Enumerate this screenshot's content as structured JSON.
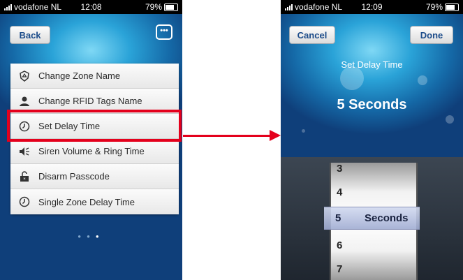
{
  "left_screen": {
    "status": {
      "carrier": "vodafone NL",
      "time": "12:08",
      "battery": "79%"
    },
    "back_label": "Back",
    "chat_icon": "chat-bubble-icon",
    "menu_items": [
      {
        "label": "Change Zone Name",
        "icon": "shield-icon"
      },
      {
        "label": "Change RFID Tags Name",
        "icon": "person-icon"
      },
      {
        "label": "Set Delay Time",
        "icon": "clock-icon"
      },
      {
        "label": "Siren Volume & Ring Time",
        "icon": "speaker-icon"
      },
      {
        "label": "Disarm Passcode",
        "icon": "lock-icon"
      },
      {
        "label": "Single Zone Delay Time",
        "icon": "clock-icon"
      }
    ],
    "highlight_color": "#e4001c",
    "page_dots": {
      "count": 3,
      "active": 3
    }
  },
  "right_screen": {
    "status": {
      "carrier": "vodafone NL",
      "time": "12:09",
      "battery": "79%"
    },
    "cancel_label": "Cancel",
    "done_label": "Done",
    "title": "Set Delay Time",
    "value_display": "5 Seconds",
    "picker": {
      "rows": [
        "3",
        "4",
        "6",
        "7"
      ],
      "selected": "5",
      "unit": "Seconds"
    }
  },
  "arrow_color": "#e4001c"
}
